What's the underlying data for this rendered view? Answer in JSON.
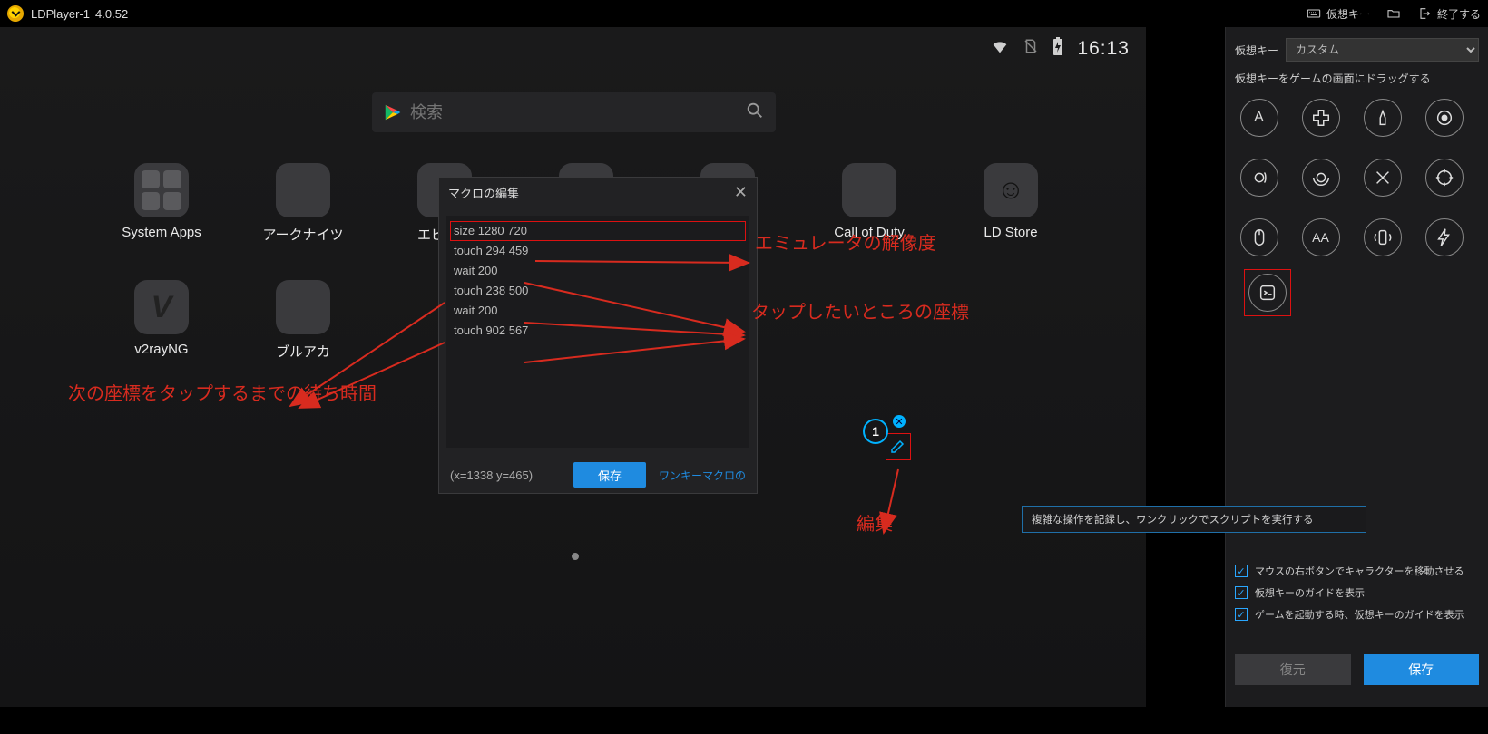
{
  "titlebar": {
    "app_name": "LDPlayer-1",
    "version": "4.0.52",
    "vkey_label": "仮想キー",
    "exit_label": "終了する"
  },
  "statusbar": {
    "time": "16:13"
  },
  "search": {
    "placeholder": "検索"
  },
  "apps": {
    "row1": [
      "System Apps",
      "アークナイツ",
      "エピック",
      "",
      "",
      "Call of Duty",
      "LD Store"
    ],
    "row2": [
      "v2rayNG",
      "ブルアカ"
    ]
  },
  "macro": {
    "title": "マクロの編集",
    "lines": [
      "size 1280 720",
      "touch 294 459",
      "wait 200",
      "touch 238 500",
      "wait 200",
      "touch 902 567"
    ],
    "coords": "(x=1338  y=465)",
    "save": "保存",
    "link": "ワンキーマクロの"
  },
  "keymarker": {
    "number": "1"
  },
  "annotations": {
    "resolution": "エミュレータの解像度",
    "tap_coords": "タップしたいところの座標",
    "wait_time": "次の座標をタップするまでの待ち時間",
    "edit": "編集"
  },
  "sidepanel": {
    "label": "仮想キー",
    "preset": "カスタム",
    "drag_hint": "仮想キーをゲームの画面にドラッグする",
    "tooltip": "複雑な操作を記録し、ワンクリックでスクリプトを実行する",
    "checks": [
      "マウスの右ボタンでキャラクターを移動させる",
      "仮想キーのガイドを表示",
      "ゲームを起動する時、仮想キーのガイドを表示"
    ],
    "restore": "復元",
    "save": "保存"
  }
}
